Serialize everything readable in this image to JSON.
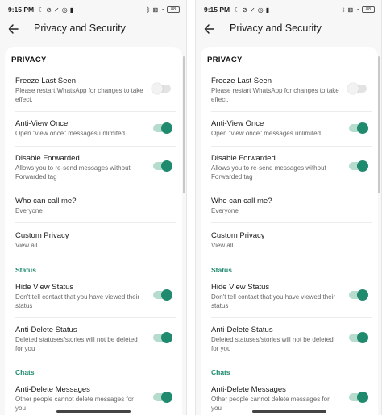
{
  "status_bar": {
    "time": "9:15 PM",
    "left_icons": [
      "moon-icon",
      "mute-icon",
      "check-icon",
      "instagram-icon",
      "lock-icon"
    ],
    "right_icons": [
      "bluetooth-icon",
      "x-box-icon",
      "wifi-icon",
      "battery-icon"
    ],
    "battery": "88"
  },
  "app_bar": {
    "title": "Privacy and Security",
    "back_icon": "arrow-left-icon"
  },
  "sections": {
    "privacy": "PRIVACY",
    "status": "Status",
    "chats": "Chats"
  },
  "settings": [
    {
      "title": "Freeze Last Seen",
      "subtitle": "Please restart WhatsApp for changes to take effect.",
      "toggle": "off"
    },
    {
      "title": "Anti-View Once",
      "subtitle": "Open \"view once\" messages unlimited",
      "toggle": "on"
    },
    {
      "title": "Disable Forwarded",
      "subtitle": "Allows you to re-send messages without Forwarded tag",
      "toggle": "on"
    },
    {
      "title": "Who can call me?",
      "subtitle": "Everyone",
      "toggle": null
    },
    {
      "title": "Custom Privacy",
      "subtitle": "View all",
      "toggle": null
    },
    {
      "title": "Hide View Status",
      "subtitle": "Don't tell contact that you have viewed their status",
      "toggle": "on"
    },
    {
      "title": "Anti-Delete Status",
      "subtitle": "Deleted statuses/stories will not be deleted for you",
      "toggle": "on"
    },
    {
      "title": "Anti-Delete Messages",
      "subtitle": "Other people cannot delete messages for you",
      "toggle": "on"
    }
  ],
  "colors": {
    "accent": "#1f8a6e",
    "toggle_track_on": "#b6dccd",
    "background": "#f7f7f7",
    "card": "#ffffff"
  }
}
